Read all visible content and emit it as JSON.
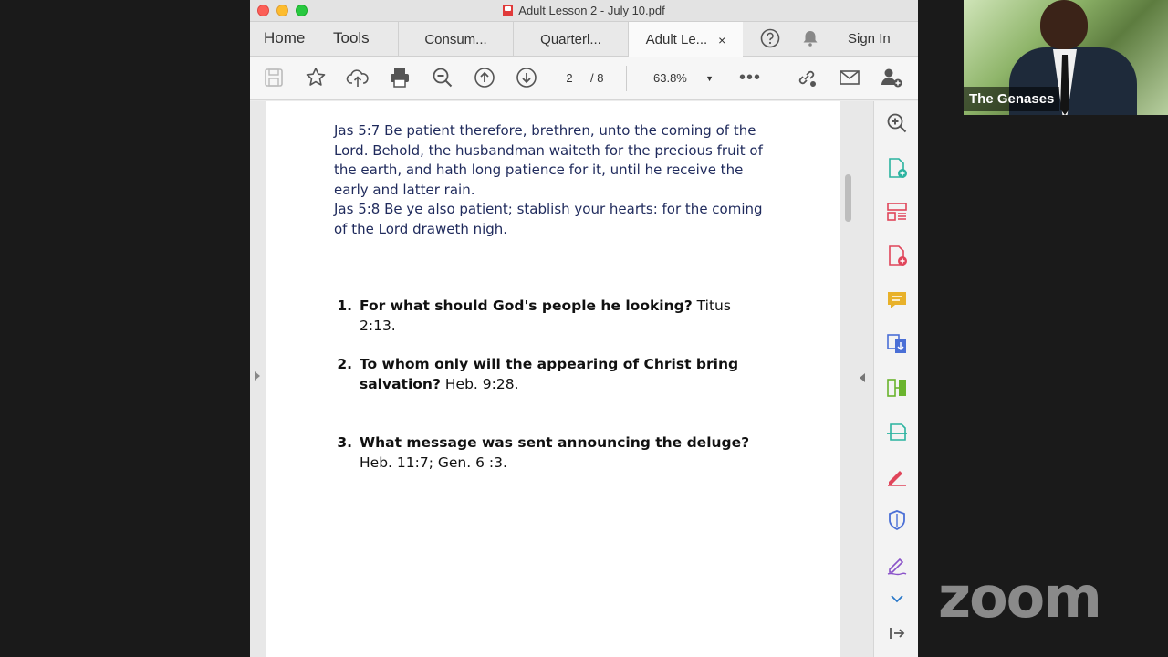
{
  "window": {
    "title": "Adult Lesson 2 - July 10.pdf"
  },
  "nav": {
    "home": "Home",
    "tools": "Tools"
  },
  "tabs": [
    {
      "label": "Consum..."
    },
    {
      "label": "Quarterl..."
    },
    {
      "label": "Adult Le...",
      "close": "×"
    }
  ],
  "header": {
    "sign_in": "Sign In"
  },
  "toolbar": {
    "page_current": "2",
    "page_total": "/ 8",
    "zoom": "63.8%",
    "more": "•••"
  },
  "document": {
    "scripture": [
      "Jas 5:7  Be patient therefore, brethren, unto the coming of the Lord. Behold, the husbandman waiteth for the precious fruit of the earth, and hath long patience for it, until he receive the early and latter rain.",
      "Jas 5:8  Be ye also patient; stablish your hearts: for the coming of the Lord draweth nigh."
    ],
    "questions": [
      {
        "num": "1.",
        "question": "For what should God's people he looking?",
        "ref": " Titus 2:13."
      },
      {
        "num": "2.",
        "question": "To whom only will the appearing of Christ bring salvation?",
        "ref": " Heb. 9:28."
      },
      {
        "num": "3.",
        "question": "What message was sent announcing the deluge?",
        "ref": "Heb. 11:7; Gen. 6 :3."
      }
    ]
  },
  "video": {
    "participant_name": "The Genases"
  },
  "branding": {
    "logo": "zoom"
  },
  "colors": {
    "scripture_text": "#1f2a5c",
    "tool_blue": "#2a78c9",
    "tool_red": "#e0455a"
  }
}
